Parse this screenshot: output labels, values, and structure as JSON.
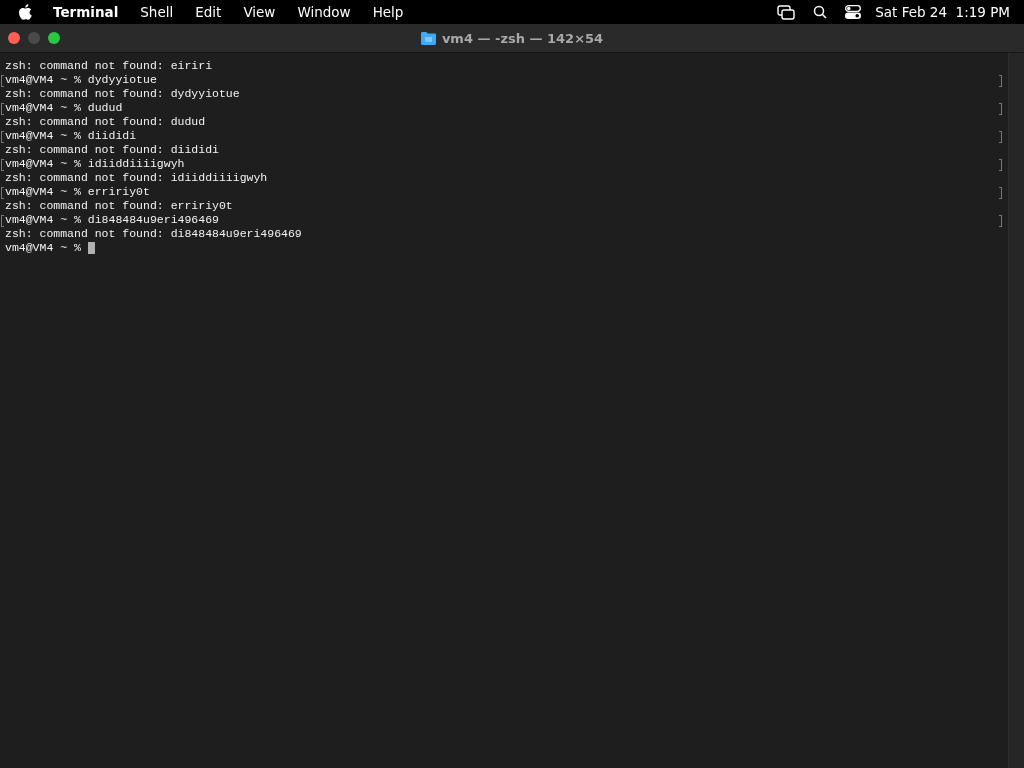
{
  "menu_bar": {
    "items": [
      {
        "label": "Terminal",
        "bold": true
      },
      {
        "label": "Shell",
        "bold": false
      },
      {
        "label": "Edit",
        "bold": false
      },
      {
        "label": "View",
        "bold": false
      },
      {
        "label": "Window",
        "bold": false
      },
      {
        "label": "Help",
        "bold": false
      }
    ],
    "clock": "Sat Feb 24  1:19 PM"
  },
  "window": {
    "title": "vm4 — -zsh — 142×54"
  },
  "terminal": {
    "lines": [
      {
        "text": "zsh: command not found: eiriri",
        "marked": false
      },
      {
        "text": "vm4@VM4 ~ % dydyyiotue",
        "marked": true
      },
      {
        "text": "zsh: command not found: dydyyiotue",
        "marked": false
      },
      {
        "text": "vm4@VM4 ~ % dudud",
        "marked": true
      },
      {
        "text": "zsh: command not found: dudud",
        "marked": false
      },
      {
        "text": "vm4@VM4 ~ % diididi",
        "marked": true
      },
      {
        "text": "zsh: command not found: diididi",
        "marked": false
      },
      {
        "text": "vm4@VM4 ~ % idiiddiiiigwyh",
        "marked": true
      },
      {
        "text": "zsh: command not found: idiiddiiiigwyh",
        "marked": false
      },
      {
        "text": "vm4@VM4 ~ % erririy0t",
        "marked": true
      },
      {
        "text": "zsh: command not found: erririy0t",
        "marked": false
      },
      {
        "text": "vm4@VM4 ~ % di848484u9eri496469",
        "marked": true
      },
      {
        "text": "zsh: command not found: di848484u9eri496469",
        "marked": false
      }
    ],
    "prompt": "vm4@VM4 ~ %"
  }
}
